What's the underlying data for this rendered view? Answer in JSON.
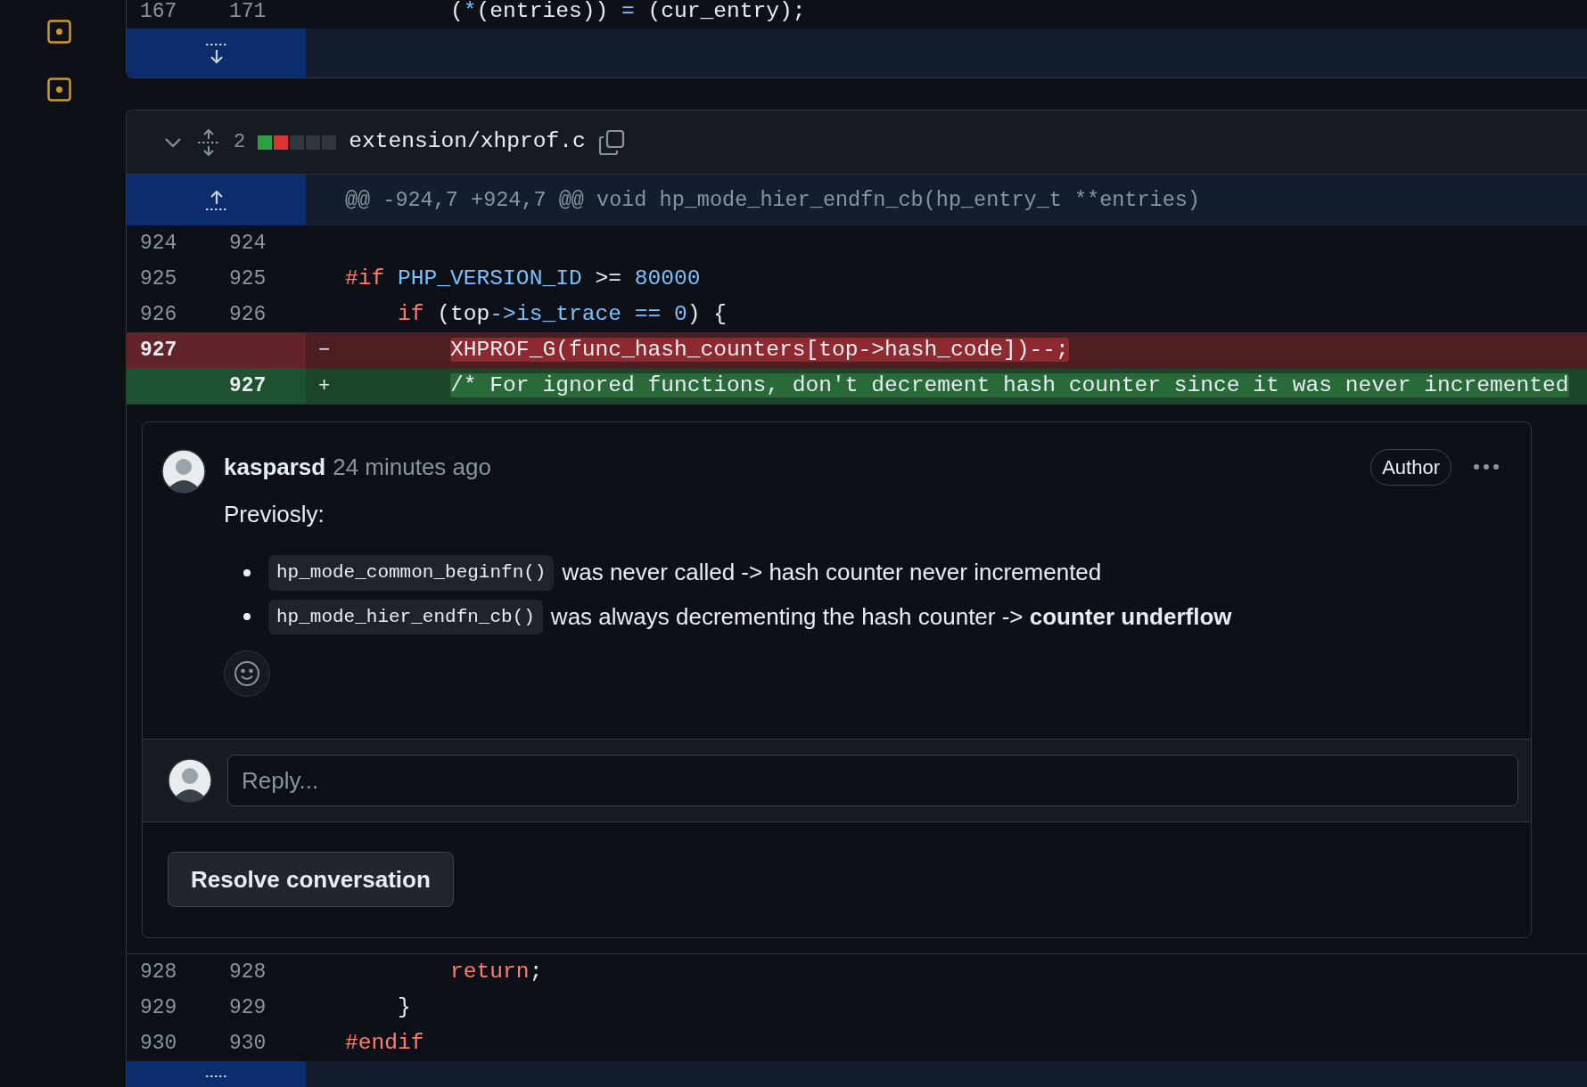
{
  "top_file": {
    "lines": [
      {
        "old": "167",
        "new": "171",
        "kind": "context",
        "tokens": [
          {
            "kind": "plain",
            "text": "        ("
          },
          {
            "kind": "constant",
            "text": "*"
          },
          {
            "kind": "plain",
            "text": "(entries)) "
          },
          {
            "kind": "constant",
            "text": "="
          },
          {
            "kind": "plain",
            "text": " (cur_entry);"
          }
        ]
      }
    ]
  },
  "file": {
    "change_count": "2",
    "diffstat": [
      {
        "kind": "added"
      },
      {
        "kind": "deleted"
      },
      {
        "kind": "neutral"
      },
      {
        "kind": "neutral"
      },
      {
        "kind": "neutral"
      }
    ],
    "path": "extension/xhprof.c",
    "hunk_header": "@@ -924,7 +924,7 @@ void hp_mode_hier_endfn_cb(hp_entry_t **entries)",
    "lines": [
      {
        "old": "924",
        "new": "924",
        "kind": "context"
      },
      {
        "old": "925",
        "new": "925",
        "kind": "context",
        "tokens": [
          {
            "kind": "keyword",
            "text": "#if"
          },
          {
            "kind": "constant",
            "text": " PHP_VERSION_ID"
          },
          {
            "kind": "plain",
            "text": " >= "
          },
          {
            "kind": "constant",
            "text": "80000"
          }
        ]
      },
      {
        "old": "926",
        "new": "926",
        "kind": "context",
        "tokens": [
          {
            "kind": "keyword",
            "text": "    if"
          },
          {
            "kind": "plain",
            "text": " (top"
          },
          {
            "kind": "constant",
            "text": "->is_trace == 0"
          },
          {
            "kind": "plain",
            "text": ") {"
          }
        ]
      },
      {
        "old": "927",
        "kind": "deletion",
        "marker": "−",
        "tokens": [
          {
            "kind": "highlight",
            "text": "        XHPROF_G(func_hash_counters[top->hash_code])--;"
          }
        ]
      },
      {
        "new": "927",
        "kind": "addition",
        "marker": "+",
        "tokens": [
          {
            "kind": "highlight",
            "text": "        /* For ignored functions, don't decrement hash counter since it was never incremented"
          }
        ]
      }
    ],
    "thread": {
      "author": "kasparsd",
      "time": "24 minutes ago",
      "badge": "Author",
      "intro": "Previosly:",
      "bullets": [
        {
          "code": "hp_mode_common_beginfn()",
          "text": "was never called -> hash counter never incremented"
        },
        {
          "code": "hp_mode_hier_endfn_cb()",
          "text": "was always decrementing the hash counter -> **counter underflow**"
        }
      ],
      "reply_placeholder": "Reply...",
      "resolve_button": "Resolve conversation"
    },
    "lines_after": [
      {
        "old": "928",
        "new": "928",
        "kind": "context",
        "tokens": [
          {
            "kind": "keyword",
            "text": "        return"
          },
          {
            "kind": "plain",
            "text": ";"
          }
        ]
      },
      {
        "old": "929",
        "new": "929",
        "kind": "context",
        "tokens": [
          {
            "kind": "plain",
            "text": "    }"
          }
        ]
      },
      {
        "old": "930",
        "new": "930",
        "kind": "context",
        "tokens": [
          {
            "kind": "keyword",
            "text": "#endif"
          }
        ]
      }
    ]
  }
}
